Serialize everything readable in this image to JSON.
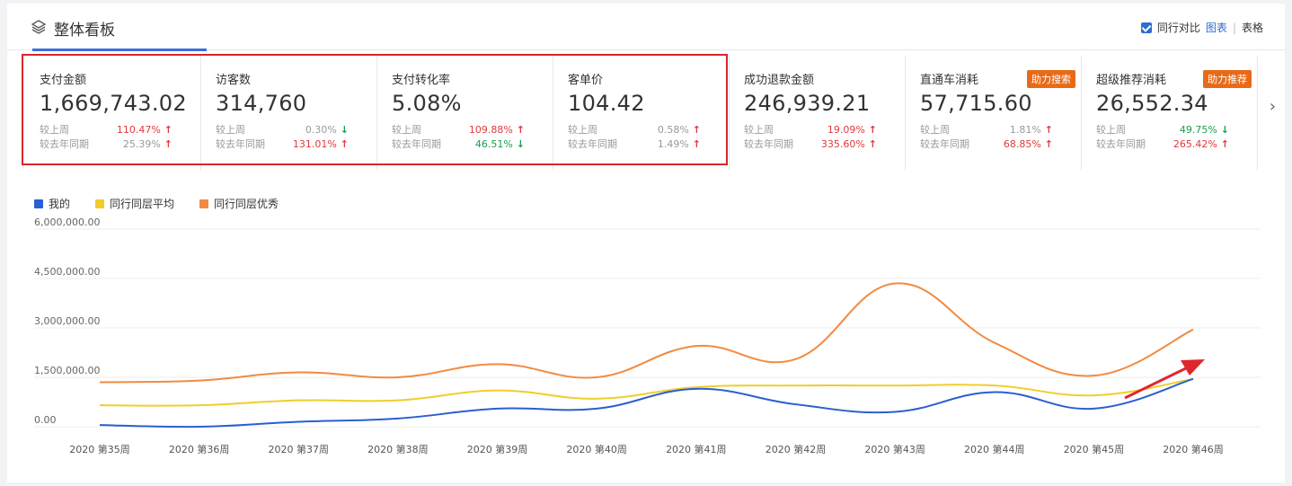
{
  "header": {
    "title": "整体看板",
    "compare_label": "同行对比",
    "view_chart": "图表",
    "view_sep": "|",
    "view_table": "表格",
    "icon": "layers-icon"
  },
  "cards": [
    {
      "label": "支付金额",
      "value": "1,669,743.02",
      "wow_label": "较上周",
      "wow": "110.47%",
      "wow_dir": "up",
      "yoy_label": "较去年同期",
      "yoy": "25.39%",
      "yoy_dir": "up"
    },
    {
      "label": "访客数",
      "value": "314,760",
      "wow_label": "较上周",
      "wow": "0.30%",
      "wow_dir": "down",
      "yoy_label": "较去年同期",
      "yoy": "131.01%",
      "yoy_dir": "up"
    },
    {
      "label": "支付转化率",
      "value": "5.08%",
      "wow_label": "较上周",
      "wow": "109.88%",
      "wow_dir": "up",
      "yoy_label": "较去年同期",
      "yoy": "46.51%",
      "yoy_dir": "down"
    },
    {
      "label": "客单价",
      "value": "104.42",
      "wow_label": "较上周",
      "wow": "0.58%",
      "wow_dir": "up",
      "yoy_label": "较去年同期",
      "yoy": "1.49%",
      "yoy_dir": "up"
    },
    {
      "label": "成功退款金额",
      "value": "246,939.21",
      "wow_label": "较上周",
      "wow": "19.09%",
      "wow_dir": "up",
      "yoy_label": "较去年同期",
      "yoy": "335.60%",
      "yoy_dir": "up"
    },
    {
      "label": "直通车消耗",
      "value": "57,715.60",
      "badge": "助力搜索",
      "wow_label": "较上周",
      "wow": "1.81%",
      "wow_dir": "up",
      "yoy_label": "较去年同期",
      "yoy": "68.85%",
      "yoy_dir": "up"
    },
    {
      "label": "超级推荐消耗",
      "value": "26,552.34",
      "badge": "助力推荐",
      "wow_label": "较上周",
      "wow": "49.75%",
      "wow_dir": "down",
      "yoy_label": "较去年同期",
      "yoy": "265.42%",
      "yoy_dir": "up"
    }
  ],
  "colors": {
    "accent": "#3d6ee0",
    "up": "#e0393e",
    "down": "#1a9f4b",
    "badge": "#e86a17",
    "highlight": "#d6262c"
  },
  "chart_data": {
    "type": "line",
    "categories": [
      "2020 第35周",
      "2020 第36周",
      "2020 第37周",
      "2020 第38周",
      "2020 第39周",
      "2020 第40周",
      "2020 第41周",
      "2020 第42周",
      "2020 第43周",
      "2020 第44周",
      "2020 第45周",
      "2020 第46周"
    ],
    "yticks": [
      "6,000,000.00",
      "4,500,000.00",
      "3,000,000.00",
      "1,500,000.00",
      "0.00"
    ],
    "ylim": [
      0,
      6000000
    ],
    "grid": true,
    "legend_position": "top-left",
    "series": [
      {
        "name": "我的",
        "color": "#2a5fcf",
        "values": [
          50000,
          0,
          150000,
          250000,
          550000,
          550000,
          1150000,
          680000,
          450000,
          1050000,
          550000,
          1450000
        ]
      },
      {
        "name": "同行同层平均",
        "color": "#f0ce2a",
        "values": [
          650000,
          650000,
          800000,
          800000,
          1100000,
          850000,
          1200000,
          1250000,
          1250000,
          1250000,
          950000,
          1450000
        ]
      },
      {
        "name": "同行同层优秀",
        "color": "#f28a40",
        "values": [
          1350000,
          1400000,
          1650000,
          1500000,
          1900000,
          1500000,
          2450000,
          2050000,
          4350000,
          2550000,
          1550000,
          2950000
        ]
      }
    ],
    "annotation": "red-arrow"
  }
}
